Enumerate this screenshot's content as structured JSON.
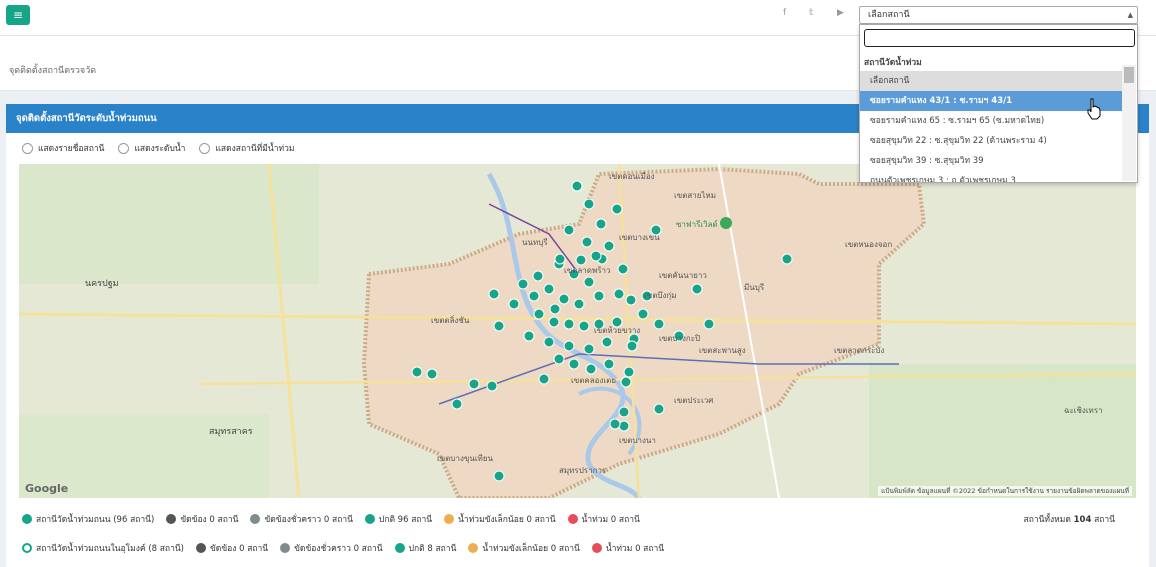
{
  "topbar": {
    "menu_icon": "hamburger-icon",
    "social": [
      "f",
      "𝕥",
      "▶"
    ],
    "select_value": "เลือกสถานี"
  },
  "subheader": {
    "breadcrumb": "จุดติดตั้งสถานีตรวจวัด"
  },
  "panel": {
    "title": "จุดติดตั้งสถานีวัดระดับน้ำท่วมถนน",
    "radios": [
      "แสดงรายชื่อสถานี",
      "แสดงระดับน้ำ",
      "แสดงสถานีที่มีน้ำท่วม"
    ]
  },
  "map": {
    "labels": [
      "เขตดอนเมือง",
      "เขตสายไหม",
      "เขตบางเขน",
      "เขตลาดพร้าว",
      "เขตคันนายาว",
      "เขตบึงกุ่ม",
      "มีนบุรี",
      "เขตหนองจอก",
      "นนทบุรี",
      "นครปฐม",
      "เขตตลิ่งชัน",
      "เขตบางกะปิ",
      "เขตสะพานสูง",
      "เขตลาดกระบัง",
      "เขตประเวศ",
      "เขตบางนา",
      "สมุทรสาคร",
      "เขตบางขุนเทียน",
      "สมุทรปราการ",
      "ฉะเชิงเทรา",
      "ซาฟารีเวิลด์",
      "เขตห้วยขวาง",
      "เขตคลองเตย"
    ],
    "google": "Google",
    "footer": "แป้นพิมพ์ลัด   ข้อมูลแผนที่ ©2022   ข้อกำหนดในการใช้งาน   รายงานข้อผิดพลาดของแผนที่"
  },
  "legend": {
    "row1": [
      {
        "label": "สถานีวัดน้ำท่วมถนน (96 สถานี)",
        "color": "#17a58a"
      },
      {
        "label": "ขัดข้อง 0 สถานี",
        "color": "#555555"
      },
      {
        "label": "ขัดข้องชั่วคราว 0 สถานี",
        "color": "#7f8c8d"
      },
      {
        "label": "ปกติ 96 สถานี",
        "color": "#17a58a"
      },
      {
        "label": "น้ำท่วมขังเล็กน้อย 0 สถานี",
        "color": "#f0ad4e"
      },
      {
        "label": "น้ำท่วม 0 สถานี",
        "color": "#e74c5c"
      }
    ],
    "row2": [
      {
        "label": "สถานีวัดน้ำท่วมถนนในอุโมงค์ (8 สถานี)",
        "color": "#17a58a"
      },
      {
        "label": "ขัดข้อง 0 สถานี",
        "color": "#555555"
      },
      {
        "label": "ขัดข้องชั่วคราว 0 สถานี",
        "color": "#7f8c8d"
      },
      {
        "label": "ปกติ 8 สถานี",
        "color": "#17a58a"
      },
      {
        "label": "น้ำท่วมขังเล็กน้อย 0 สถานี",
        "color": "#f0ad4e"
      },
      {
        "label": "น้ำท่วม 0 สถานี",
        "color": "#e74c5c"
      }
    ],
    "total_label": "สถานีทั้งหมด",
    "total_value": "104",
    "total_unit": "สถานี"
  },
  "dropdown": {
    "group": "สถานีวัดน้ำท่วม",
    "options": [
      "เลือกสถานี",
      "ซอยรามคำแหง 43/1 : ซ.รามฯ 43/1",
      "ซอยรามคำแหง 65 : ซ.รามฯ 65 (ซ.มหาดไทย)",
      "ซอยสุขุมวิท 22 : ซ.สุขุมวิท 22 (ด้านพระราม 4)",
      "ซอยสุขุมวิท 39 : ซ.สุขุมวิท 39",
      "ถนนตัวเพชรเกษม 3 : ถ.ตัวเพชรเกษม 3"
    ]
  }
}
